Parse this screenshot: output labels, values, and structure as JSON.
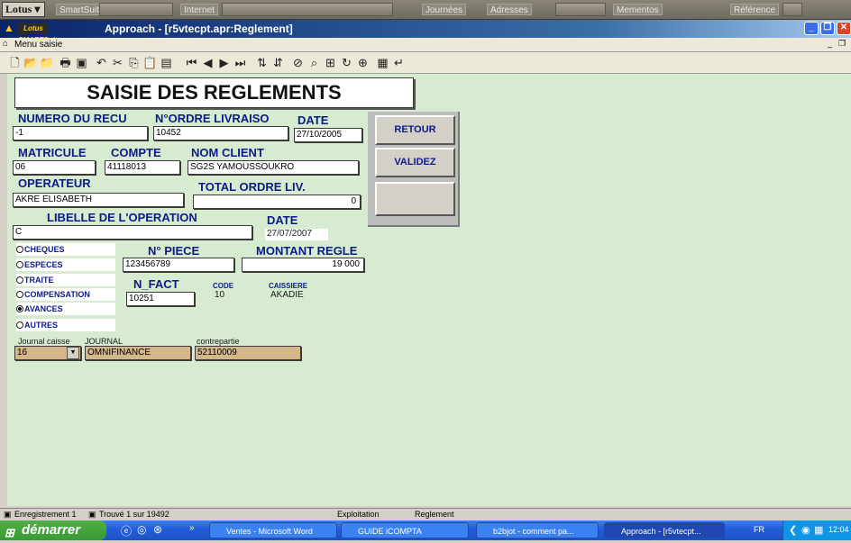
{
  "suite": {
    "logo": "Lotus",
    "items": [
      "SmartSuite",
      "Internet",
      "Journées",
      "Adresses",
      "Mementos",
      "Référence"
    ]
  },
  "window": {
    "badge": "Lotus SMARTSuite",
    "title": "Approach - [r5vtecpt.apr:Reglement]"
  },
  "menu": {
    "label": "Menu saisie"
  },
  "form": {
    "title": "SAISIE DES REGLEMENTS",
    "labels": {
      "numero_recu": "NUMERO DU RECU",
      "ordre_livraison": "N°ORDRE LIVRAISO",
      "date1": "DATE",
      "matricule": "MATRICULE",
      "compte": "COMPTE",
      "nom_client": "NOM CLIENT",
      "operateur": "OPERATEUR",
      "total_ordre": "TOTAL ORDRE LIV.",
      "libelle": "LIBELLE DE L'OPERATION",
      "date2": "DATE",
      "n_piece": "N° PIECE",
      "montant": "MONTANT REGLE",
      "n_fact": "N_FACT",
      "code": "CODE",
      "caissiere": "CAISSIERE",
      "journal_caisse": "Journal caisse",
      "journal": "JOURNAL",
      "contrepartie": "contrepartie"
    },
    "values": {
      "numero_recu": "-1",
      "ordre_livraison": "10452",
      "date1": "27/10/2005",
      "matricule": "06",
      "compte": "41118013",
      "nom_client": "SG2S YAMOUSSOUKRO",
      "operateur": "AKRE  ELISABETH",
      "total_ordre": "0",
      "libelle": "C",
      "date2": "27/07/2007",
      "n_piece": "123456789",
      "montant": "19 000",
      "n_fact": "10251",
      "code": "10",
      "caissiere": "AKADIE",
      "journal_caisse": "16",
      "journal": "OMNIFINANCE",
      "contrepartie": "52110009"
    },
    "buttons": {
      "retour": "RETOUR",
      "valider": "VALIDEZ",
      "blank": ""
    },
    "payment_modes": [
      {
        "label": "CHEQUES",
        "selected": false
      },
      {
        "label": "ESPECES",
        "selected": false
      },
      {
        "label": "TRAITE",
        "selected": false
      },
      {
        "label": "COMPENSATION",
        "selected": false
      },
      {
        "label": "AVANCES",
        "selected": true
      },
      {
        "label": "AUTRES",
        "selected": false
      }
    ]
  },
  "status": {
    "record": "Enregistrement 1",
    "found": "Trouvé 1 sur 19492",
    "mode": "Exploitation",
    "view": "Reglement"
  },
  "taskbar": {
    "start": "démarrer",
    "tasks": [
      "Ventes - Microsoft Word",
      "GUIDE iCOMPTA",
      "b2bjot - comment pa...",
      "Approach - [r5vtecpt..."
    ],
    "lang": "FR",
    "clock": "12:04"
  }
}
